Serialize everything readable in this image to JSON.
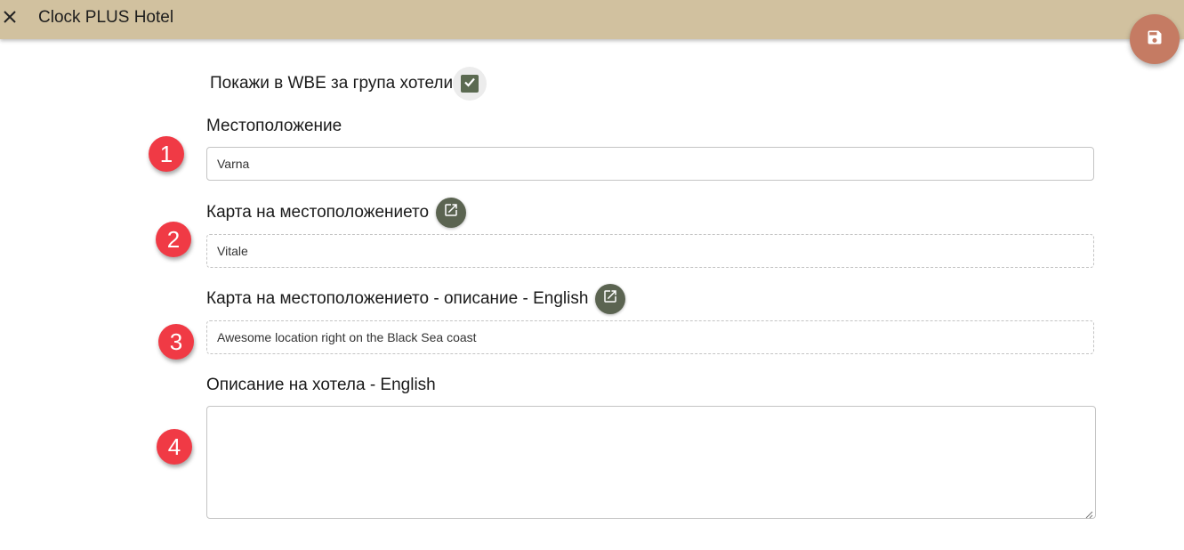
{
  "header": {
    "title": "Clock PLUS Hotel",
    "close_icon": "close-icon",
    "save_icon": "save-floppy-icon",
    "background_color": "#d1c19f",
    "save_button_color": "#c57b63"
  },
  "form": {
    "show_in_wbe": {
      "label": "Покажи в WBE за група хотели",
      "checked": true
    },
    "location": {
      "label": "Местоположение",
      "value": "Varna",
      "badge": "1"
    },
    "location_map": {
      "label": "Карта на местоположението",
      "value": "Vitale",
      "badge": "2",
      "icon": "open-external-icon"
    },
    "location_map_description": {
      "label": "Карта на местоположението - описание - English",
      "value": "Awesome location right on the Black Sea coast",
      "badge": "3",
      "icon": "open-external-icon"
    },
    "hotel_description": {
      "label": "Описание на хотела - English",
      "value": "",
      "badge": "4"
    }
  },
  "colors": {
    "accent_dark": "#5b6451",
    "badge_red": "#f03a45"
  }
}
